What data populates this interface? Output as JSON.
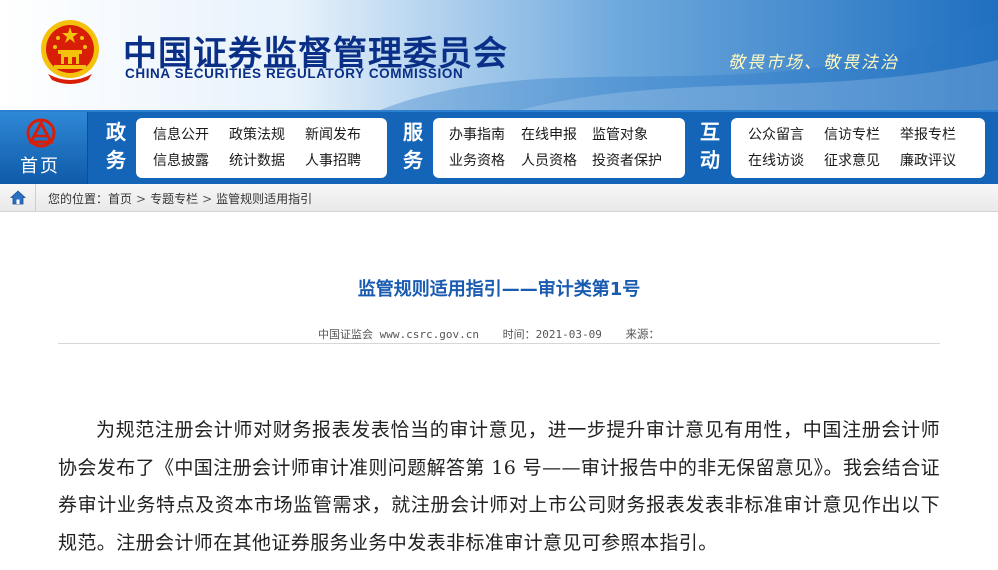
{
  "header": {
    "title_cn": "中国证券监督管理委员会",
    "title_en": "CHINA SECURITIES REGULATORY COMMISSION",
    "slogan": "敬畏市场、敬畏法治",
    "emblem_icon": "national-emblem-icon"
  },
  "nav": {
    "home_label": "首页",
    "home_icon": "csrc-logo-icon",
    "groups": [
      {
        "title_1": "政",
        "title_2": "务",
        "items_row1": [
          "信息公开",
          "政策法规",
          "新闻发布"
        ],
        "items_row2": [
          "信息披露",
          "统计数据",
          "人事招聘"
        ]
      },
      {
        "title_1": "服",
        "title_2": "务",
        "items_row1": [
          "办事指南",
          "在线申报",
          "监管对象"
        ],
        "items_row2": [
          "业务资格",
          "人员资格",
          "投资者保护"
        ]
      },
      {
        "title_1": "互",
        "title_2": "动",
        "items_row1": [
          "公众留言",
          "信访专栏",
          "举报专栏"
        ],
        "items_row2": [
          "在线访谈",
          "征求意见",
          "廉政评议"
        ]
      }
    ]
  },
  "breadcrumb": {
    "home_icon": "home-icon",
    "prefix": "您的位置：",
    "items": [
      "首页",
      "专题专栏",
      "监管规则适用指引"
    ],
    "separator": ">"
  },
  "article": {
    "title": "监管规则适用指引——审计类第1号",
    "source": "中国证监会 www.csrc.gov.cn",
    "time": "时间：2021-03-09",
    "origin": "来源：",
    "body": "为规范注册会计师对财务报表发表恰当的审计意见，进一步提升审计意见有用性，中国注册会计师协会发布了《中国注册会计师审计准则问题解答第 16 号——审计报告中的非无保留意见》。我会结合证券审计业务特点及资本市场监管需求，就注册会计师对上市公司财务报表发表非标准审计意见作出以下规范。注册会计师在其他证券服务业务中发表非标准审计意见可参照本指引。"
  },
  "colors": {
    "nav_blue": "#1465b7",
    "title_navy": "#0a2f86",
    "article_title_blue": "#1a5bb0",
    "emblem_red": "#d81e06",
    "emblem_gold": "#f4c20d"
  }
}
